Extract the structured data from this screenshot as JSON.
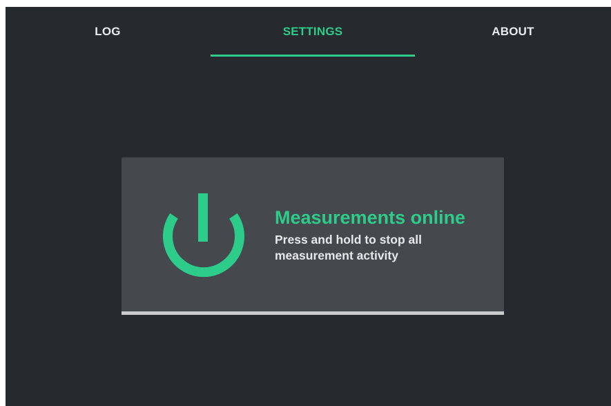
{
  "tabs": [
    {
      "label": "LOG",
      "active": false
    },
    {
      "label": "SETTINGS",
      "active": true
    },
    {
      "label": "ABOUT",
      "active": false
    }
  ],
  "measurement_card": {
    "icon": "power-icon",
    "title": "Measurements online",
    "description": "Press and hold to stop all measurement activity",
    "hold_progress": 1.0
  },
  "colors": {
    "background": "#262a2e",
    "card": "#45494d",
    "accent": "#2ecc8a",
    "text": "#e9ecee",
    "progress": "#c9cbcc"
  }
}
